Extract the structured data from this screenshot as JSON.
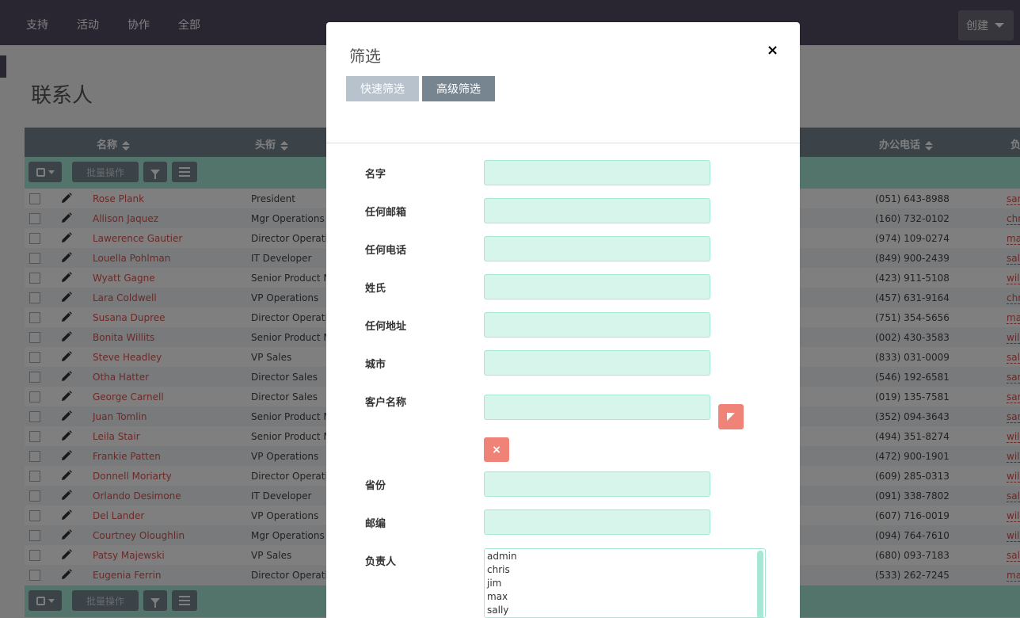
{
  "nav": {
    "items": [
      "支持",
      "活动",
      "协作",
      "全部"
    ],
    "create_label": "创建"
  },
  "page": {
    "title": "联系人"
  },
  "table": {
    "headers": {
      "name": "名称",
      "title": "头衔",
      "phone": "办公电话",
      "user": "负"
    },
    "bulk_label": "批量操作",
    "rows": [
      {
        "name": "Rose Plank",
        "title": "President",
        "phone": "(051) 643-8988",
        "user": "sar"
      },
      {
        "name": "Allison Jaquez",
        "title": "Mgr Operations",
        "phone": "(160) 732-0102",
        "user": "chr"
      },
      {
        "name": "Lawerence Gautier",
        "title": "Director Operatio",
        "phone": "(974) 109-0274",
        "user": "ma"
      },
      {
        "name": "Louella Pohlman",
        "title": "IT Developer",
        "phone": "(849) 900-2439",
        "user": "sal"
      },
      {
        "name": "Wyatt Gagne",
        "title": "Senior Product Ma",
        "phone": "(423) 911-5108",
        "user": "wil"
      },
      {
        "name": "Lara Coldwell",
        "title": "VP Operations",
        "phone": "(457) 631-9164",
        "user": "chr"
      },
      {
        "name": "Susana Dupree",
        "title": "Director Operatio",
        "phone": "(751) 354-5656",
        "user": "ma"
      },
      {
        "name": "Bonita Willits",
        "title": "Senior Product Ma",
        "phone": "(002) 430-3583",
        "user": "wil"
      },
      {
        "name": "Steve Headley",
        "title": "VP Sales",
        "phone": "(833) 031-0009",
        "user": "sal"
      },
      {
        "name": "Otha Hatter",
        "title": "Director Sales",
        "phone": "(546) 192-6581",
        "user": "sar"
      },
      {
        "name": "George Carnell",
        "title": "Director Sales",
        "phone": "(019) 135-7581",
        "user": "sar"
      },
      {
        "name": "Juan Tomlin",
        "title": "Senior Product Ma",
        "phone": "(352) 094-3643",
        "user": "sar"
      },
      {
        "name": "Leila Stair",
        "title": "Senior Product Ma",
        "phone": "(494) 351-8274",
        "user": "wil"
      },
      {
        "name": "Frankie Patten",
        "title": "VP Operations",
        "phone": "(472) 900-1901",
        "user": "wil"
      },
      {
        "name": "Donnell Moriarty",
        "title": "Director Operatio",
        "phone": "(609) 285-0313",
        "user": "wil"
      },
      {
        "name": "Orlando Desimone",
        "title": "IT Developer",
        "phone": "(091) 338-7802",
        "user": "sal"
      },
      {
        "name": "Del Lander",
        "title": "VP Operations",
        "phone": "(607) 716-0019",
        "user": "wil"
      },
      {
        "name": "Courtney Oloughlin",
        "title": "Mgr Operations",
        "phone": "(094) 764-7610",
        "user": "wil"
      },
      {
        "name": "Patsy Majewski",
        "title": "VP Sales",
        "phone": "(680) 093-7183",
        "user": "sal"
      },
      {
        "name": "Eugenia Ferrin",
        "title": "Director Operatio",
        "phone": "(533) 262-7245",
        "user": "ma"
      }
    ]
  },
  "modal": {
    "title": "筛选",
    "close": "×",
    "tabs": {
      "quick": "快速筛选",
      "advanced": "高级筛选"
    },
    "fields": {
      "first_name": "名字",
      "any_email": "任何邮箱",
      "any_phone": "任何电话",
      "last_name": "姓氏",
      "any_address": "任何地址",
      "city": "城市",
      "account_name": "客户名称",
      "state": "省份",
      "postal_code": "邮编",
      "assigned_to": "负责人"
    },
    "clear_glyph": "×",
    "assigned_options": [
      "admin",
      "chris",
      "jim",
      "max",
      "sally"
    ]
  }
}
